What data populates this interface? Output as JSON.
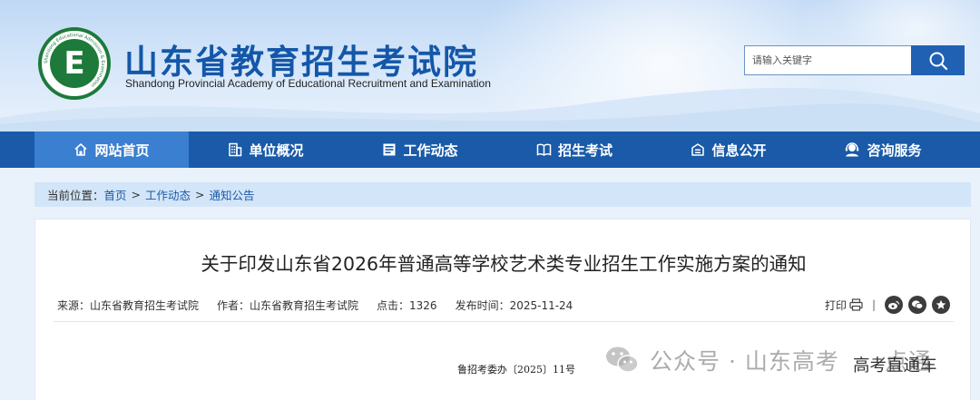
{
  "header": {
    "site_title": "山东省教育招生考试院",
    "site_subtitle": "Shandong Provincial Academy of Educational Recruitment and Examination",
    "logo_letter": "E",
    "logo_ring_text": "Shandong Educational Admission & Examination",
    "logo_bottom_text": "山东省教育招生考试院"
  },
  "search": {
    "placeholder": "请输入关键字",
    "button_icon": "search-icon"
  },
  "nav": {
    "items": [
      {
        "label": "网站首页",
        "icon": "home-icon"
      },
      {
        "label": "单位概况",
        "icon": "building-icon"
      },
      {
        "label": "工作动态",
        "icon": "news-icon"
      },
      {
        "label": "招生考试",
        "icon": "book-icon"
      },
      {
        "label": "信息公开",
        "icon": "info-icon"
      },
      {
        "label": "咨询服务",
        "icon": "support-icon"
      }
    ],
    "active_index": 0
  },
  "breadcrumb": {
    "prefix": "当前位置：",
    "items": [
      "首页",
      "工作动态",
      "通知公告"
    ],
    "separator": ">"
  },
  "article": {
    "title": "关于印发山东省2026年普通高等学校艺术类专业招生工作实施方案的通知",
    "meta": {
      "source": "来源：山东省教育招生考试院",
      "author": "作者：山东省教育招生考试院",
      "clicks": "点击：1326",
      "published": "发布时间：2025-11-24"
    },
    "print_label": "打印",
    "tool_separator": "|",
    "doc_number": "鲁招考委办〔2025〕11号"
  },
  "watermark": {
    "text": "公众号 · 山东高考",
    "text_tail": "点通",
    "channel": "高考直通车"
  },
  "colors": {
    "brand_blue": "#1a5aa8",
    "nav_active": "#3b7fd0",
    "logo_green": "#1d7a3a"
  }
}
